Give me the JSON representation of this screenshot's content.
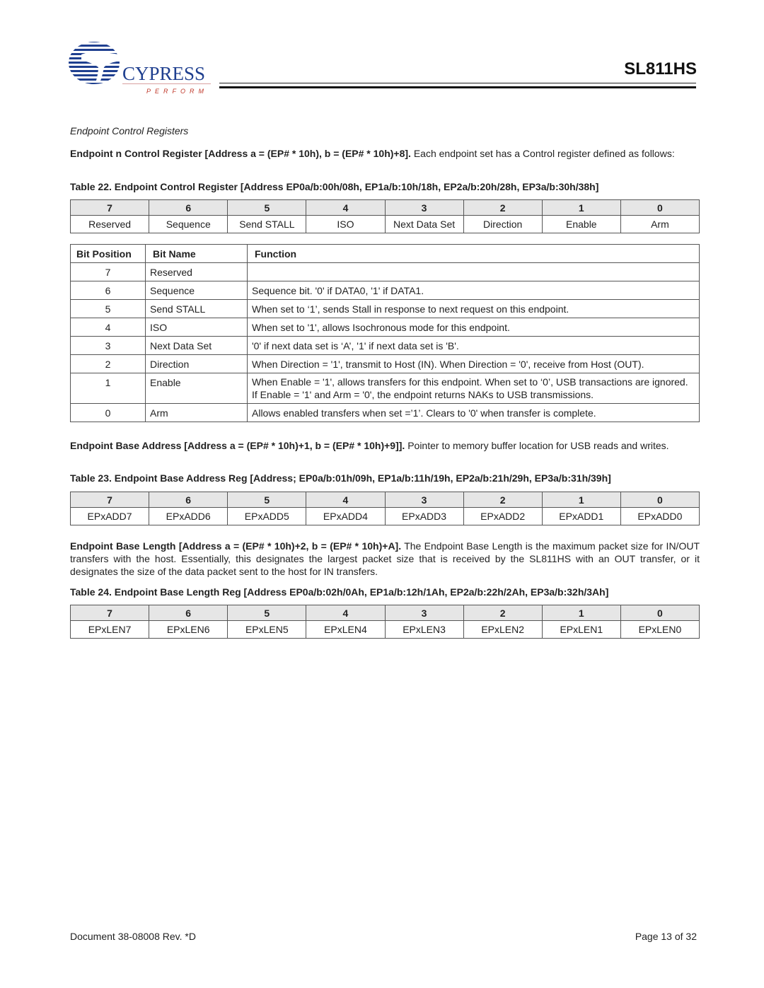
{
  "header": {
    "logo_text": "CYPRESS",
    "logo_tagline": "PERFORM",
    "doc_title": "SL811HS"
  },
  "section_title": "Endpoint Control Registers",
  "para_control": {
    "bold": "Endpoint n Control Register [Address a = (EP# * 10h), b = (EP# * 10h)+8].",
    "text": " Each endpoint set has a Control register defined as follows:"
  },
  "table22": {
    "caption": "Table 22.  Endpoint Control Register [Address EP0a/b:00h/08h, EP1a/b:10h/18h, EP2a/b:20h/28h, EP3a/b:30h/38h]",
    "bits": [
      "7",
      "6",
      "5",
      "4",
      "3",
      "2",
      "1",
      "0"
    ],
    "names": [
      "Reserved",
      "Sequence",
      "Send STALL",
      "ISO",
      "Next Data Set",
      "Direction",
      "Enable",
      "Arm"
    ]
  },
  "bit_table": {
    "headers": [
      "Bit Position",
      "Bit Name",
      "Function"
    ],
    "rows": [
      {
        "pos": "7",
        "name": "Reserved",
        "func": ""
      },
      {
        "pos": "6",
        "name": "Sequence",
        "func": "Sequence bit. '0' if DATA0, '1' if DATA1."
      },
      {
        "pos": "5",
        "name": "Send STALL",
        "func": "When set to ‘1’, sends Stall in response to next request on this endpoint."
      },
      {
        "pos": "4",
        "name": "ISO",
        "func": "When set to '1', allows Isochronous mode for this endpoint."
      },
      {
        "pos": "3",
        "name": "Next Data Set",
        "func": "'0' if next data set is ‘A’, '1' if next data set is 'B'."
      },
      {
        "pos": "2",
        "name": "Direction",
        "func": "When Direction = '1', transmit to Host (IN). When Direction = '0', receive from Host (OUT)."
      },
      {
        "pos": "1",
        "name": "Enable",
        "func": "When Enable = '1', allows transfers for this endpoint. When set to ‘0’, USB transactions are ignored. If Enable = '1' and Arm = '0', the endpoint returns NAKs to USB transmissions."
      },
      {
        "pos": "0",
        "name": "Arm",
        "func": "Allows enabled transfers when set =’1’. Clears to '0' when transfer is complete."
      }
    ]
  },
  "para_base_address": {
    "bold": "Endpoint Base Address [Address a = (EP# * 10h)+1, b = (EP# * 10h)+9]].",
    "text": " Pointer to memory buffer location for USB reads and writes."
  },
  "table23": {
    "caption": "Table 23.  Endpoint Base Address Reg [Address; EP0a/b:01h/09h, EP1a/b:11h/19h, EP2a/b:21h/29h, EP3a/b:31h/39h]",
    "bits": [
      "7",
      "6",
      "5",
      "4",
      "3",
      "2",
      "1",
      "0"
    ],
    "names": [
      "EPxADD7",
      "EPxADD6",
      "EPxADD5",
      "EPxADD4",
      "EPxADD3",
      "EPxADD2",
      "EPxADD1",
      "EPxADD0"
    ]
  },
  "para_base_length": {
    "bold": "Endpoint Base Length [Address a = (EP# * 10h)+2, b = (EP# * 10h)+A].",
    "text": " The Endpoint Base Length is the maximum packet size for IN/OUT transfers with the host. Essentially, this designates the largest packet size that is received by the SL811HS with an OUT transfer, or it designates the size of the data packet sent to the host for IN transfers."
  },
  "table24": {
    "caption": "Table 24.  Endpoint Base Length Reg [Address EP0a/b:02h/0Ah, EP1a/b:12h/1Ah, EP2a/b:22h/2Ah, EP3a/b:32h/3Ah]",
    "bits": [
      "7",
      "6",
      "5",
      "4",
      "3",
      "2",
      "1",
      "0"
    ],
    "names": [
      "EPxLEN7",
      "EPxLEN6",
      "EPxLEN5",
      "EPxLEN4",
      "EPxLEN3",
      "EPxLEN2",
      "EPxLEN1",
      "EPxLEN0"
    ]
  },
  "footer": {
    "document": "Document 38-08008 Rev. *D",
    "page": "Page 13 of 32"
  },
  "colors": {
    "logo_blue": "#1f3f8f",
    "tagline_red": "#c0392b",
    "table_header_gray": "#e6e6e6"
  }
}
